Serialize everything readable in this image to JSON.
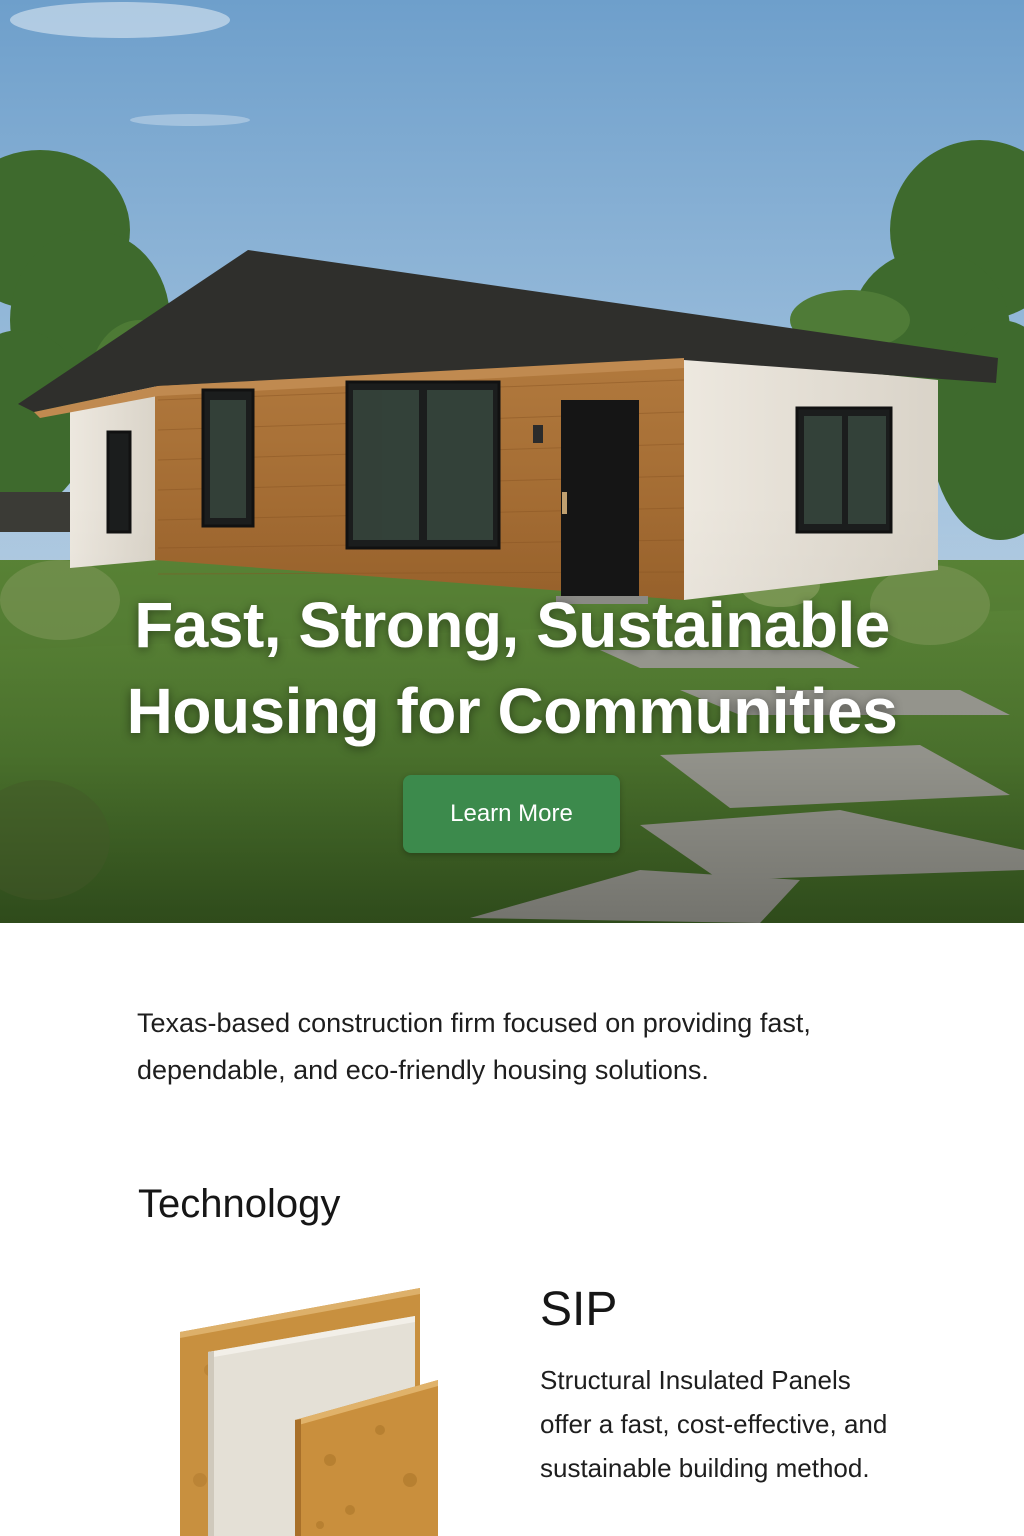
{
  "hero": {
    "title_line1": "Fast, Strong, Sustainable",
    "title_line2": "Housing for Communities",
    "cta_label": "Learn More",
    "cta_color": "#3c8a4c"
  },
  "intro": {
    "text": "Texas-based construction firm focused on providing fast, dependable, and eco-friendly housing solutions."
  },
  "technology": {
    "heading": "Technology",
    "items": [
      {
        "title": "SIP",
        "description": "Structural Insulated Panels offer a fast, cost-effective, and sustainable building method.",
        "icon": "sip-panel-icon"
      }
    ]
  }
}
